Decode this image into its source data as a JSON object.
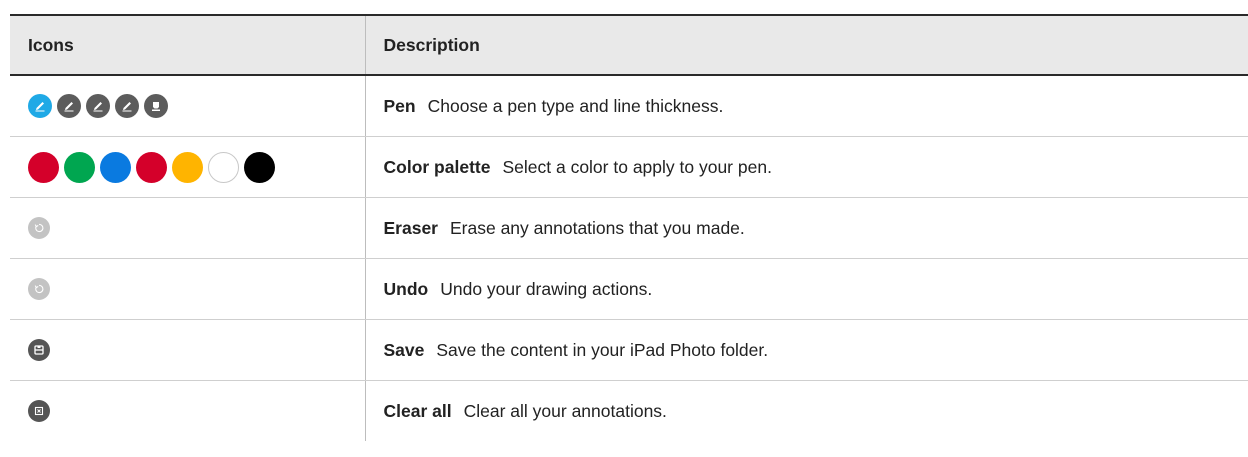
{
  "table": {
    "headers": {
      "icons": "Icons",
      "description": "Description"
    },
    "rows": [
      {
        "term": "Pen",
        "description": "Choose a pen type and line thickness."
      },
      {
        "term": "Color palette",
        "description": "Select a color to apply to your pen."
      },
      {
        "term": "Eraser",
        "description": "Erase any annotations that you made."
      },
      {
        "term": "Undo",
        "description": "Undo your drawing actions."
      },
      {
        "term": "Save",
        "description": "Save the content in your iPad Photo folder."
      },
      {
        "term": "Clear all",
        "description": "Clear all your annotations."
      }
    ]
  },
  "icons": {
    "pen_colors": [
      "#1fa9e6",
      "#5c5c5c",
      "#5c5c5c",
      "#5c5c5c",
      "#5c5c5c"
    ],
    "palette_colors": [
      "#d4002a",
      "#00a650",
      "#0a7ae0",
      "#d4002a",
      "#ffb400",
      "#ffffff",
      "#000000"
    ],
    "eraser_color": "#c3c3c3",
    "undo_color": "#c3c3c3",
    "save_color": "#555555",
    "clear_color": "#555555"
  }
}
